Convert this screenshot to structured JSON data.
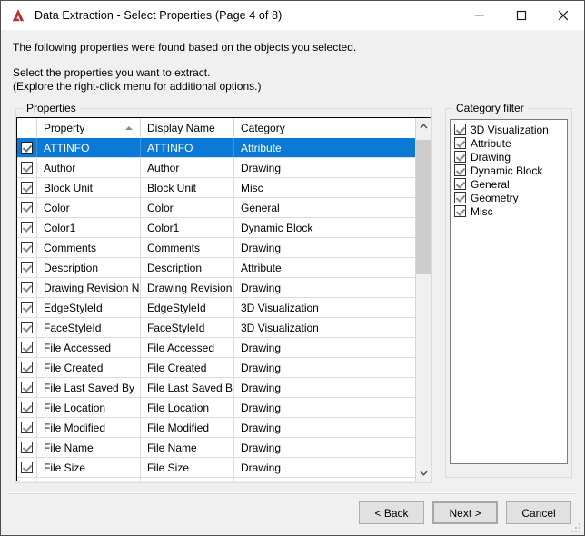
{
  "window": {
    "title": "Data Extraction - Select Properties (Page 4 of 8)",
    "app_icon": "autocad-a-icon",
    "controls": {
      "minimize": "minimize-icon",
      "maximize": "maximize-icon",
      "close": "close-icon"
    }
  },
  "instructions": {
    "line1": "The following properties were found based on the objects you selected.",
    "line2": "Select the properties you want to extract.",
    "line3": "(Explore the right-click menu for additional options.)"
  },
  "properties_panel": {
    "legend": "Properties",
    "columns": [
      "",
      "Property",
      "Display Name",
      "Category"
    ],
    "sort": {
      "column": "Property",
      "direction": "ascending",
      "icon": "sort-ascending-arrow-icon"
    },
    "rows": [
      {
        "checked": true,
        "selected": true,
        "property": "ATTINFO",
        "display_name": "ATTINFO",
        "category": "Attribute"
      },
      {
        "checked": true,
        "selected": false,
        "property": "Author",
        "display_name": "Author",
        "category": "Drawing"
      },
      {
        "checked": true,
        "selected": false,
        "property": "Block Unit",
        "display_name": "Block Unit",
        "category": "Misc"
      },
      {
        "checked": true,
        "selected": false,
        "property": "Color",
        "display_name": "Color",
        "category": "General"
      },
      {
        "checked": true,
        "selected": false,
        "property": "Color1",
        "display_name": "Color1",
        "category": "Dynamic Block"
      },
      {
        "checked": true,
        "selected": false,
        "property": "Comments",
        "display_name": "Comments",
        "category": "Drawing"
      },
      {
        "checked": true,
        "selected": false,
        "property": "Description",
        "display_name": "Description",
        "category": "Attribute"
      },
      {
        "checked": true,
        "selected": false,
        "property": "Drawing Revision N...",
        "display_name": "Drawing Revision...",
        "category": "Drawing"
      },
      {
        "checked": true,
        "selected": false,
        "property": "EdgeStyleId",
        "display_name": "EdgeStyleId",
        "category": "3D Visualization"
      },
      {
        "checked": true,
        "selected": false,
        "property": "FaceStyleId",
        "display_name": "FaceStyleId",
        "category": "3D Visualization"
      },
      {
        "checked": true,
        "selected": false,
        "property": "File Accessed",
        "display_name": "File Accessed",
        "category": "Drawing"
      },
      {
        "checked": true,
        "selected": false,
        "property": "File Created",
        "display_name": "File Created",
        "category": "Drawing"
      },
      {
        "checked": true,
        "selected": false,
        "property": "File Last Saved By",
        "display_name": "File Last Saved By",
        "category": "Drawing"
      },
      {
        "checked": true,
        "selected": false,
        "property": "File Location",
        "display_name": "File Location",
        "category": "Drawing"
      },
      {
        "checked": true,
        "selected": false,
        "property": "File Modified",
        "display_name": "File Modified",
        "category": "Drawing"
      },
      {
        "checked": true,
        "selected": false,
        "property": "File Name",
        "display_name": "File Name",
        "category": "Drawing"
      },
      {
        "checked": true,
        "selected": false,
        "property": "File Size",
        "display_name": "File Size",
        "category": "Drawing"
      }
    ],
    "scrollbar": {
      "up_icon": "chevron-up-icon",
      "down_icon": "chevron-down-icon"
    }
  },
  "category_filter": {
    "legend": "Category filter",
    "items": [
      {
        "label": "3D Visualization",
        "checked": true
      },
      {
        "label": "Attribute",
        "checked": true
      },
      {
        "label": "Drawing",
        "checked": true
      },
      {
        "label": "Dynamic Block",
        "checked": true
      },
      {
        "label": "General",
        "checked": true
      },
      {
        "label": "Geometry",
        "checked": true
      },
      {
        "label": "Misc",
        "checked": true
      }
    ]
  },
  "footer": {
    "back_label": "< Back",
    "next_label": "Next >",
    "cancel_label": "Cancel"
  },
  "colors": {
    "selection_blue": "#0a7ad6",
    "brand_red": "#b3342c",
    "dialog_bg": "#f0f0f0"
  }
}
